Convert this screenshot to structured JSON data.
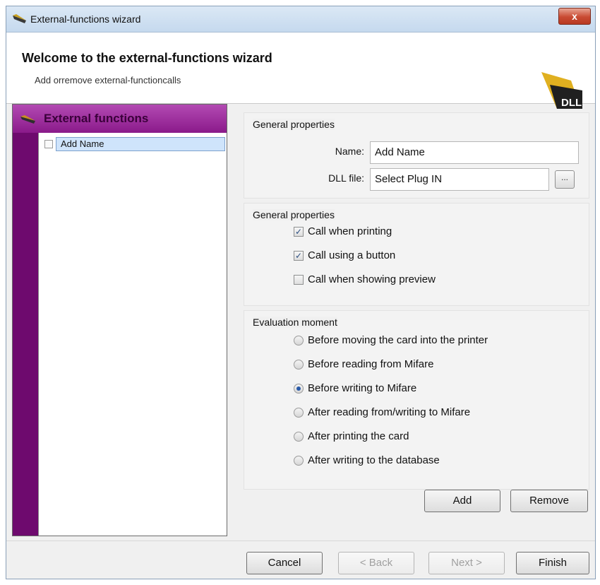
{
  "window": {
    "title": "External-functions wizard",
    "close_label": "x"
  },
  "header": {
    "title": "Welcome to the external-functions wizard",
    "subtitle": "Add orremove external-functioncalls",
    "logo_text": "DLL"
  },
  "sidebar": {
    "title": "External functions",
    "items": [
      {
        "label": "Add Name",
        "selected": true
      }
    ]
  },
  "general_properties": {
    "label": "General properties",
    "name_label": "Name:",
    "name_value": "Add Name",
    "dll_label": "DLL file:",
    "dll_value": "Select Plug IN",
    "browse_label": "..."
  },
  "call_properties": {
    "label": "General properties",
    "options": [
      {
        "label": "Call when printing",
        "checked": true
      },
      {
        "label": "Call using a button",
        "checked": true
      },
      {
        "label": "Call when showing preview",
        "checked": false
      }
    ]
  },
  "evaluation": {
    "label": "Evaluation moment",
    "options": [
      {
        "label": "Before moving the card into the printer",
        "selected": false
      },
      {
        "label": "Before reading from Mifare",
        "selected": false
      },
      {
        "label": "Before writing to Mifare",
        "selected": true
      },
      {
        "label": "After reading from/writing to Mifare",
        "selected": false
      },
      {
        "label": "After printing the card",
        "selected": false
      },
      {
        "label": "After writing to the database",
        "selected": false
      }
    ]
  },
  "actions": {
    "add": "Add",
    "remove": "Remove"
  },
  "footer": {
    "cancel": "Cancel",
    "back": "< Back",
    "next": "Next >",
    "finish": "Finish"
  },
  "colors": {
    "sidebar_accent": "#8a1a8a",
    "selection": "#cfe4fb",
    "close": "#c94a32"
  }
}
